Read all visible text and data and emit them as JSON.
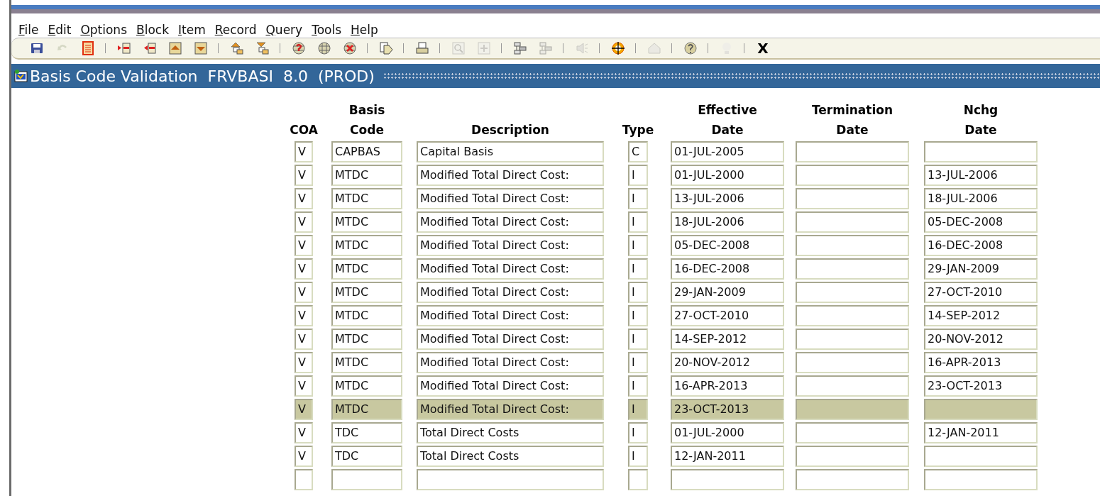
{
  "menu": [
    "File",
    "Edit",
    "Options",
    "Block",
    "Item",
    "Record",
    "Query",
    "Tools",
    "Help"
  ],
  "toolbar": [
    [
      {
        "disabled": false
      },
      {
        "disabled": true
      },
      {
        "disabled": false
      }
    ],
    [
      {
        "disabled": false
      },
      {
        "disabled": false
      },
      {
        "disabled": false
      },
      {
        "disabled": false
      }
    ],
    [
      {
        "disabled": false
      },
      {
        "disabled": false
      }
    ],
    [
      {
        "disabled": false
      },
      {
        "disabled": false
      },
      {
        "disabled": false
      }
    ],
    [
      {
        "disabled": false
      }
    ],
    [
      {
        "disabled": false
      }
    ],
    [
      {
        "disabled": true
      },
      {
        "disabled": true
      }
    ],
    [
      {
        "disabled": false
      },
      {
        "disabled": true
      }
    ],
    [
      {
        "disabled": true
      }
    ],
    [
      {
        "disabled": false
      }
    ],
    [
      {
        "disabled": true
      }
    ],
    [
      {
        "disabled": false
      }
    ],
    [
      {
        "disabled": true
      }
    ]
  ],
  "exit_label": "X",
  "form_title": "Basis Code Validation  FRVBASI  8.0  (PROD)",
  "columns": [
    [
      "COA"
    ],
    [
      "Basis",
      "Code"
    ],
    [
      "Description"
    ],
    [
      "Type"
    ],
    [
      "Effective",
      "Date"
    ],
    [
      "Termination",
      "Date"
    ],
    [
      "Nchg",
      "Date"
    ]
  ],
  "rows": [
    {
      "coa": "V",
      "code": "CAPBAS",
      "description": "Capital Basis",
      "type": "C",
      "effective": "01-JUL-2005",
      "selected": false
    },
    {
      "coa": "V",
      "code": "MTDC",
      "description": "Modified Total Direct Cost:",
      "type": "I",
      "effective": "01-JUL-2000",
      "nchg": "13-JUL-2006",
      "selected": false
    },
    {
      "coa": "V",
      "code": "MTDC",
      "description": "Modified Total Direct Cost:",
      "type": "I",
      "effective": "13-JUL-2006",
      "nchg": "18-JUL-2006",
      "selected": false
    },
    {
      "coa": "V",
      "code": "MTDC",
      "description": "Modified Total Direct Cost:",
      "type": "I",
      "effective": "18-JUL-2006",
      "nchg": "05-DEC-2008",
      "selected": false
    },
    {
      "coa": "V",
      "code": "MTDC",
      "description": "Modified Total Direct Cost:",
      "type": "I",
      "effective": "05-DEC-2008",
      "nchg": "16-DEC-2008",
      "selected": false
    },
    {
      "coa": "V",
      "code": "MTDC",
      "description": "Modified Total Direct Cost:",
      "type": "I",
      "effective": "16-DEC-2008",
      "nchg": "29-JAN-2009",
      "selected": false
    },
    {
      "coa": "V",
      "code": "MTDC",
      "description": "Modified Total Direct Cost:",
      "type": "I",
      "effective": "29-JAN-2009",
      "nchg": "27-OCT-2010",
      "selected": false
    },
    {
      "coa": "V",
      "code": "MTDC",
      "description": "Modified Total Direct Cost:",
      "type": "I",
      "effective": "27-OCT-2010",
      "nchg": "14-SEP-2012",
      "selected": false
    },
    {
      "coa": "V",
      "code": "MTDC",
      "description": "Modified Total Direct Cost:",
      "type": "I",
      "effective": "14-SEP-2012",
      "nchg": "20-NOV-2012",
      "selected": false
    },
    {
      "coa": "V",
      "code": "MTDC",
      "description": "Modified Total Direct Cost:",
      "type": "I",
      "effective": "20-NOV-2012",
      "nchg": "16-APR-2013",
      "selected": false
    },
    {
      "coa": "V",
      "code": "MTDC",
      "description": "Modified Total Direct Cost:",
      "type": "I",
      "effective": "16-APR-2013",
      "nchg": "23-OCT-2013",
      "selected": false
    },
    {
      "coa": "V",
      "code": "MTDC",
      "description": "Modified Total Direct Cost:",
      "type": "I",
      "effective": "23-OCT-2013",
      "selected": true
    },
    {
      "coa": "V",
      "code": "TDC",
      "description": "Total Direct Costs",
      "type": "I",
      "effective": "01-JUL-2000",
      "nchg": "12-JAN-2011",
      "selected": false
    },
    {
      "coa": "V",
      "code": "TDC",
      "description": "Total Direct Costs",
      "type": "I",
      "effective": "12-JAN-2011",
      "selected": false
    },
    {
      "selected": false
    }
  ]
}
